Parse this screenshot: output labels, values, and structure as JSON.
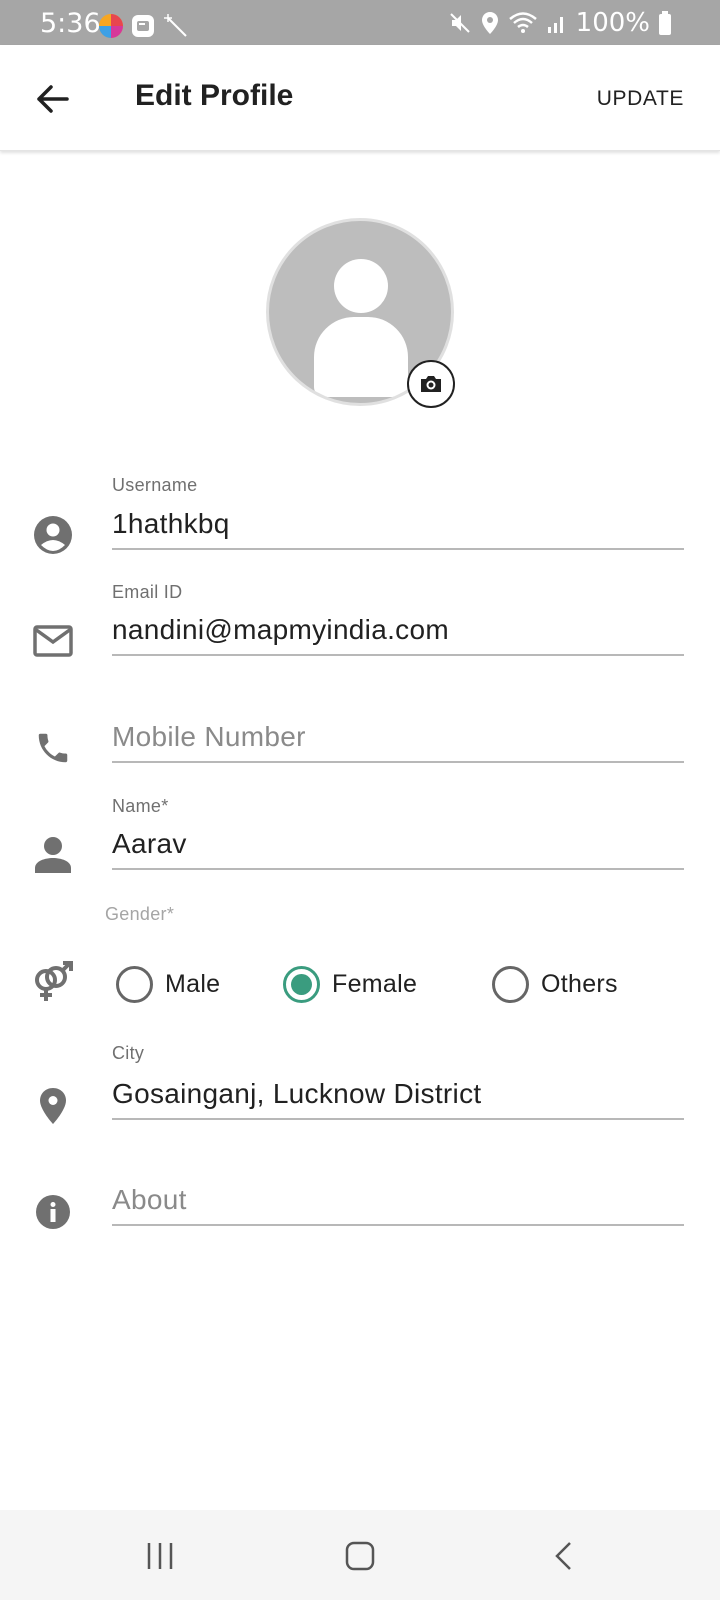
{
  "status_bar": {
    "time": "5:36",
    "battery": "100%",
    "icons": [
      "mute-icon",
      "location-icon",
      "wifi-icon",
      "signal-icon",
      "battery-icon"
    ]
  },
  "app_bar": {
    "title": "Edit Profile",
    "update_label": "UPDATE",
    "back_icon": "arrow-left-icon"
  },
  "avatar": {
    "camera_icon": "camera-icon"
  },
  "form": {
    "username": {
      "label": "Username",
      "value": "1hathkbq",
      "icon": "account-circle-icon"
    },
    "email": {
      "label": "Email ID",
      "value": "nandini@mapmyindia.com",
      "icon": "mail-icon"
    },
    "mobile": {
      "placeholder": "Mobile Number",
      "value": "",
      "icon": "phone-icon"
    },
    "name": {
      "label": "Name*",
      "value": "Aarav",
      "icon": "person-icon"
    },
    "gender": {
      "label": "Gender*",
      "icon": "gender-icon",
      "options": [
        "Male",
        "Female",
        "Others"
      ],
      "selected": "Female"
    },
    "city": {
      "label": "City",
      "value": "Gosainganj, Lucknow District",
      "icon": "location-pin-icon"
    },
    "about": {
      "placeholder": "About",
      "value": "",
      "icon": "info-icon"
    }
  },
  "colors": {
    "accent": "#3a9c7f",
    "status_bar": "#a6a6a6",
    "icon_gray": "#707070"
  },
  "nav_bar": {
    "icons": [
      "recent-apps-icon",
      "home-icon",
      "back-nav-icon"
    ]
  }
}
